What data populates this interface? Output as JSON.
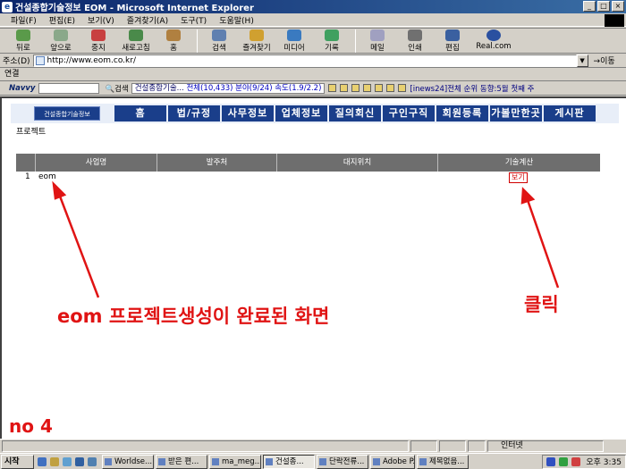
{
  "window": {
    "title": "건설종합기술정보 EOM - Microsoft Internet Explorer"
  },
  "menu": [
    "파일(F)",
    "편집(E)",
    "보기(V)",
    "즐겨찾기(A)",
    "도구(T)",
    "도움말(H)"
  ],
  "toolbar": [
    "뒤로",
    "앞으로",
    "중지",
    "새로고침",
    "홈",
    "검색",
    "즐겨찾기",
    "미디어",
    "기록",
    "메일",
    "인쇄",
    "편집",
    "Real.com"
  ],
  "address": {
    "label": "주소(D)",
    "value": "http://www.eom.co.kr/",
    "go": "이동"
  },
  "links": "연결",
  "navvy": {
    "brand": "Navvy",
    "search_label": "검색",
    "query": "건설종합기술...",
    "results": "전체(10,433) 분야(9/24) 속도(1.9/2.2)",
    "news": "[inews24]전체 순위 동향:5월 첫째 주"
  },
  "site": {
    "logo": "건설종합기술정보",
    "menu": [
      "홈",
      "법/규정",
      "사무정보",
      "업체정보",
      "질의회신",
      "구인구직",
      "회원등록",
      "가볼만한곳",
      "게시판"
    ],
    "crumb": "프로젝트"
  },
  "table": {
    "headers": [
      "사업명",
      "발주처",
      "대지위치",
      "기술계산"
    ],
    "rows": [
      {
        "no": "1",
        "name": "eom",
        "action": "보기"
      }
    ]
  },
  "annotations": {
    "main": "eom 프로젝트생성이 완료된 화면",
    "click": "클릭",
    "page": "no 4"
  },
  "status": {
    "zone": "인터넷"
  },
  "taskbar": {
    "start": "시작",
    "tasks": [
      "Worldse...",
      "받은 편...",
      "ma_meg...",
      "건설종...",
      "단락전류...",
      "Adobe P...",
      "제목없음..."
    ],
    "clock": "오후 3:35"
  },
  "colors": {
    "nav": "#1a3e8a",
    "annotation": "#e01414",
    "thead": "#6e6e6e"
  }
}
